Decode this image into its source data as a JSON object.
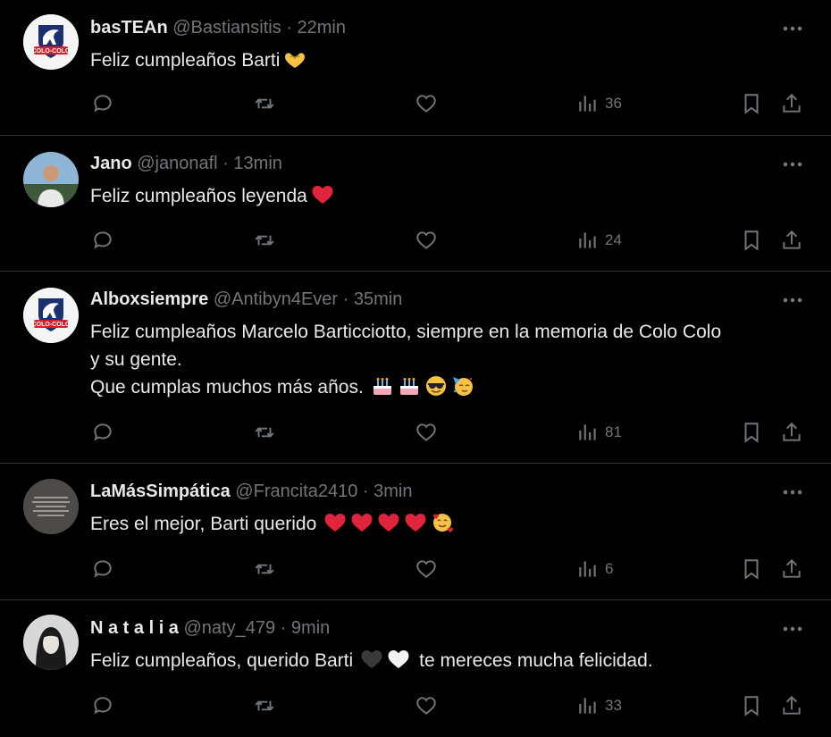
{
  "colors": {
    "background": "#000000",
    "text": "#e7e9ea",
    "muted": "#71767b",
    "divider": "#2f3336",
    "heart_red": "#e0243b"
  },
  "tweets": [
    {
      "name": "basTEAn",
      "handle": "@Bastiansitis",
      "separator": "·",
      "time": "22min",
      "avatar": "colo-colo-logo-avatar",
      "lines": [
        "Feliz cumpleaños Barti"
      ],
      "emojis": [
        "heart-hands"
      ],
      "views": "36"
    },
    {
      "name": "Jano",
      "handle": "@janonafl",
      "separator": "·",
      "time": "13min",
      "avatar": "photo-avatar",
      "lines": [
        "Feliz cumpleaños leyenda"
      ],
      "emojis": [
        "red-heart"
      ],
      "views": "24"
    },
    {
      "name": "Alboxsiempre",
      "handle": "@Antibyn4Ever",
      "separator": "·",
      "time": "35min",
      "avatar": "colo-colo-logo-avatar",
      "lines": [
        "Feliz cumpleaños Marcelo Barticciotto, siempre en la memoria de Colo Colo",
        "y su gente.",
        "Que cumplas muchos más años."
      ],
      "emojis": [
        "birthday-cake",
        "birthday-cake",
        "sunglasses-face",
        "partying-face"
      ],
      "views": "81"
    },
    {
      "name": "LaMásSimpática",
      "handle": "@Francita2410",
      "separator": "·",
      "time": "3min",
      "avatar": "text-image-avatar",
      "lines": [
        "Eres el mejor, Barti querido"
      ],
      "emojis": [
        "red-heart",
        "red-heart",
        "red-heart",
        "red-heart",
        "smiling-face-with-hearts"
      ],
      "views": "6"
    },
    {
      "name": "N a t a l i a",
      "handle": "@naty_479",
      "separator": "·",
      "time": "9min",
      "avatar": "portrait-avatar",
      "lines": [
        "Feliz cumpleaños, querido Barti"
      ],
      "emojis": [
        "black-heart",
        "white-heart"
      ],
      "trailing_text": "te mereces mucha felicidad.",
      "views": "33"
    }
  ]
}
